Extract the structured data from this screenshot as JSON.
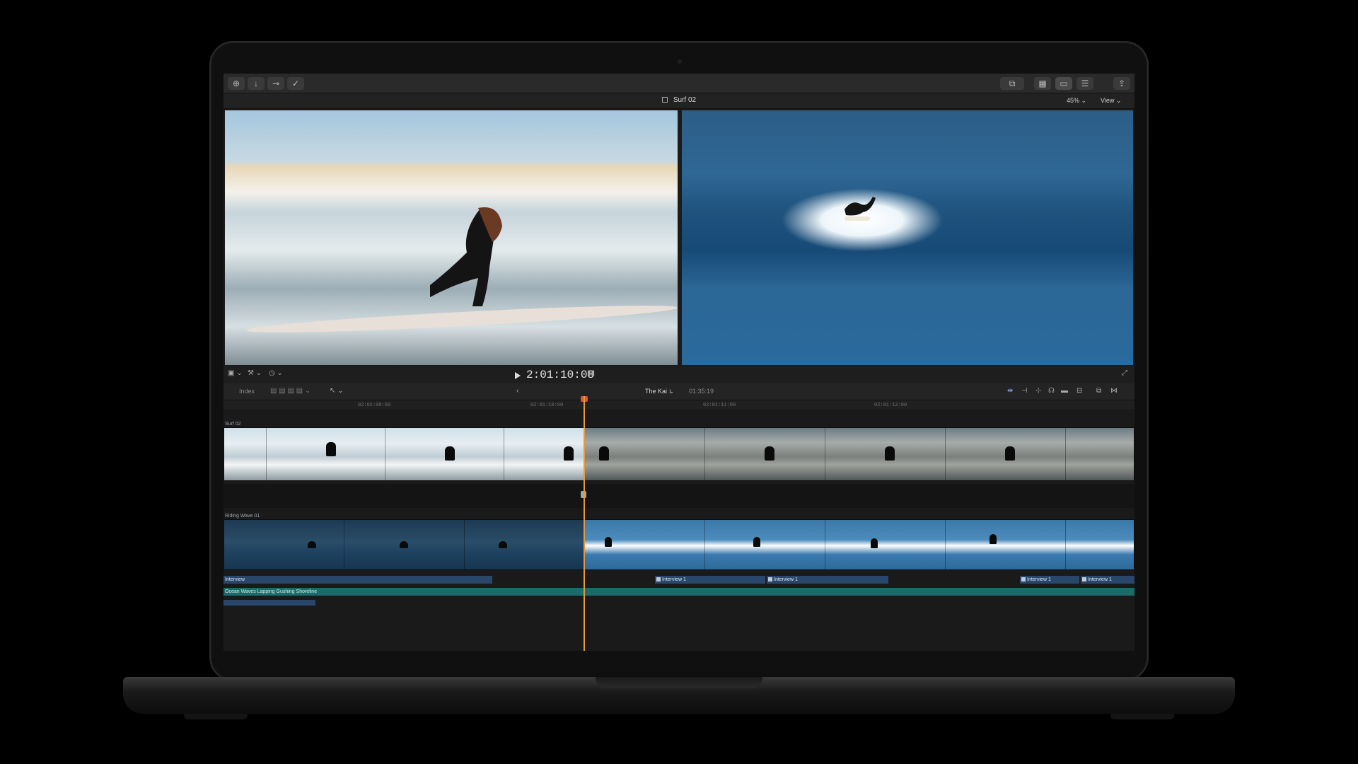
{
  "toolbar": {
    "left_icons": [
      "import-icon",
      "download-icon",
      "keyword-icon",
      "checkmark-icon"
    ],
    "right_icons": [
      "media-browser-icon",
      "grid-icon",
      "filmstrip-icon",
      "inspector-icon",
      "share-icon"
    ]
  },
  "viewer": {
    "title": "Surf 02",
    "zoom": "45%",
    "view_menu": "View"
  },
  "transport": {
    "timecode": "2:01:10:08"
  },
  "timeline_bar": {
    "index_label": "Index",
    "project_name": "The Kai",
    "duration": "01:35:19"
  },
  "ruler": {
    "ticks": [
      "02:01:09:00",
      "02:01:10:00",
      "02:01:11:00",
      "02:01:12:00"
    ]
  },
  "lanes": {
    "top_clip_label": "Surf 02",
    "mid_clip_label": "Riding Wave 01",
    "audio": {
      "interview_main": "Interview",
      "interview_1a": "Interview 1",
      "interview_1b": "Interview 1",
      "interview_1c": "Interview 1",
      "interview_1d": "Interview 1",
      "ocean": "Ocean Waves Lapping Gushing Shoreline"
    }
  },
  "colors": {
    "playhead": "#e79a3c",
    "audio_blue": "#29476b",
    "audio_teal": "#1b6b6a"
  }
}
